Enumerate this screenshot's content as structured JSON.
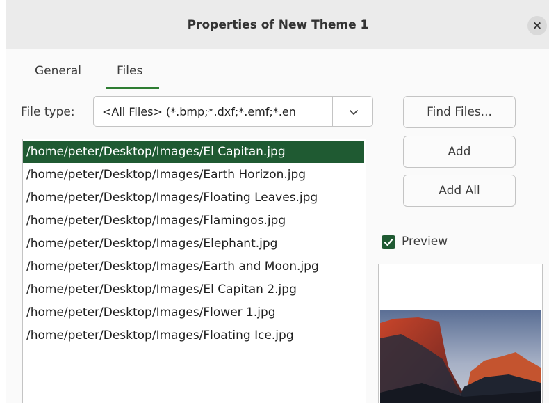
{
  "window": {
    "title": "Properties of New Theme 1",
    "close_glyph": "×"
  },
  "tabs": [
    {
      "label": "General",
      "active": false
    },
    {
      "label": "Files",
      "active": true
    }
  ],
  "file_type": {
    "label": "File type:",
    "value": "<All Files> (*.bmp;*.dxf;*.emf;*.en"
  },
  "files": [
    "/home/peter/Desktop/Images/El Capitan.jpg",
    "/home/peter/Desktop/Images/Earth Horizon.jpg",
    "/home/peter/Desktop/Images/Floating Leaves.jpg",
    "/home/peter/Desktop/Images/Flamingos.jpg",
    "/home/peter/Desktop/Images/Elephant.jpg",
    "/home/peter/Desktop/Images/Earth and Moon.jpg",
    "/home/peter/Desktop/Images/El Capitan 2.jpg",
    "/home/peter/Desktop/Images/Flower 1.jpg",
    "/home/peter/Desktop/Images/Floating Ice.jpg"
  ],
  "selected_file_index": 0,
  "buttons": {
    "find_files": "Find Files...",
    "add": "Add",
    "add_all": "Add All"
  },
  "preview": {
    "label": "Preview",
    "checked": true
  },
  "colors": {
    "accent": "#1f5a32",
    "tab_underline": "#2e7d32"
  }
}
